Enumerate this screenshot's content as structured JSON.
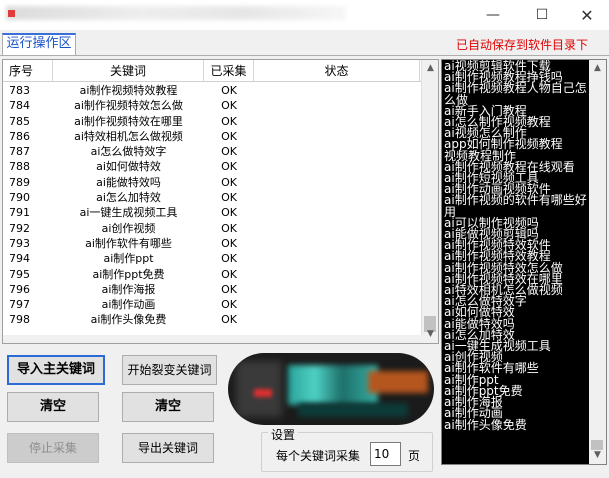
{
  "window": {
    "minimize": "—",
    "maximize": "☐",
    "close": "✕"
  },
  "tab": {
    "label": "运行操作区"
  },
  "autosave_notice": "已自动保存到软件目录下",
  "grid": {
    "columns": [
      "序号",
      "关键词",
      "已采集",
      "状态"
    ],
    "rows": [
      {
        "no": "783",
        "kw": "ai制作视频特效教程",
        "done": "OK"
      },
      {
        "no": "784",
        "kw": "ai制作视频特效怎么做",
        "done": "OK"
      },
      {
        "no": "785",
        "kw": "ai制作视频特效在哪里",
        "done": "OK"
      },
      {
        "no": "786",
        "kw": "ai特效相机怎么做视频",
        "done": "OK"
      },
      {
        "no": "787",
        "kw": "ai怎么做特效字",
        "done": "OK"
      },
      {
        "no": "788",
        "kw": "ai如何做特效",
        "done": "OK"
      },
      {
        "no": "789",
        "kw": "ai能做特效吗",
        "done": "OK"
      },
      {
        "no": "790",
        "kw": "ai怎么加特效",
        "done": "OK"
      },
      {
        "no": "791",
        "kw": "ai一键生成视频工具",
        "done": "OK"
      },
      {
        "no": "792",
        "kw": "ai创作视频",
        "done": "OK"
      },
      {
        "no": "793",
        "kw": "ai制作软件有哪些",
        "done": "OK"
      },
      {
        "no": "794",
        "kw": "ai制作ppt",
        "done": "OK"
      },
      {
        "no": "795",
        "kw": "ai制作ppt免费",
        "done": "OK"
      },
      {
        "no": "796",
        "kw": "ai制作海报",
        "done": "OK"
      },
      {
        "no": "797",
        "kw": "ai制作动画",
        "done": "OK"
      },
      {
        "no": "798",
        "kw": "ai制作头像免费",
        "done": "OK"
      }
    ]
  },
  "buttons": {
    "import": "导入主关键词",
    "start_split": "开始裂变关键词",
    "clear_left": "清空",
    "clear_right": "清空",
    "stop": "停止采集",
    "export": "导出关键词"
  },
  "settings": {
    "title": "设置",
    "pages_label": "每个关键词采集",
    "pages_value": "10",
    "pages_unit": "页"
  },
  "log": [
    "ai视频剪辑软件下载",
    "ai制作视频教程挣钱吗",
    "ai制作视频教程人物自己怎么做",
    "ai新手入门教程",
    "ai怎么制作视频教程",
    "ai视频怎么制作",
    "app如何制作视频教程",
    "视频教程制作",
    "ai制作视频教程在线观看",
    "ai制作短视频工具",
    "ai制作动画视频软件",
    "ai制作视频的软件有哪些好用",
    "ai可以制作视频吗",
    "ai能做视频剪辑吗",
    "ai制作视频特效软件",
    "ai制作视频特效教程",
    "ai制作视频特效怎么做",
    "ai制作视频特效在哪里",
    "ai特效相机怎么做视频",
    "ai怎么做特效字",
    "ai如何做特效",
    "ai能做特效吗",
    "ai怎么加特效",
    "ai一键生成视频工具",
    "ai创作视频",
    "ai制作软件有哪些",
    "ai制作ppt",
    "ai制作ppt免费",
    "ai制作海报",
    "ai制作动画",
    "ai制作头像免费"
  ]
}
